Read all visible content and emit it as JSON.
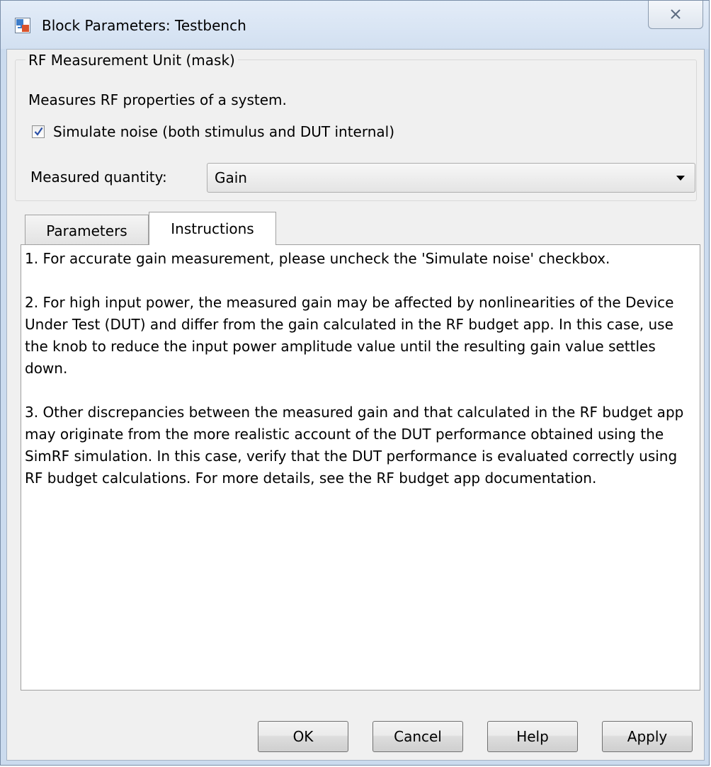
{
  "window": {
    "title": "Block Parameters: Testbench"
  },
  "mask": {
    "group_title": "RF Measurement Unit (mask)",
    "description": "Measures RF properties of a system.",
    "simulate_noise": {
      "label": "Simulate noise (both stimulus and DUT internal)",
      "checked": true
    },
    "measured_quantity": {
      "label": "Measured quantity:",
      "value": "Gain"
    }
  },
  "tabs": [
    {
      "label": "Parameters",
      "active": false
    },
    {
      "label": "Instructions",
      "active": true
    }
  ],
  "instructions": {
    "paragraphs": [
      "1. For accurate gain measurement, please uncheck the 'Simulate noise' checkbox.",
      "2. For high input power, the measured gain may be affected by nonlinearities of the Device Under Test (DUT) and differ from the gain calculated in the RF budget app. In this case, use the knob to reduce the input power amplitude value until the resulting gain value settles down.",
      "3. Other discrepancies between the measured gain and that calculated in the RF budget app may originate from the more realistic account of the DUT performance obtained using the SimRF simulation. In this case, verify that the DUT performance is evaluated correctly using RF budget calculations. For more details, see the RF budget app documentation."
    ]
  },
  "buttons": {
    "ok": "OK",
    "cancel": "Cancel",
    "help": "Help",
    "apply": "Apply"
  },
  "icons": {
    "app": "simulink-block-icon",
    "close": "close-icon",
    "check": "checkmark-icon",
    "dropdown": "chevron-down-icon"
  }
}
